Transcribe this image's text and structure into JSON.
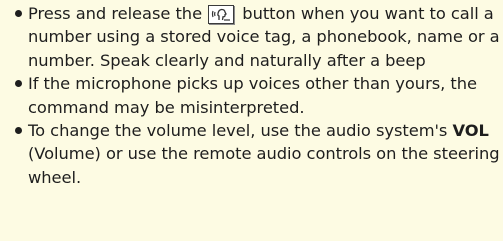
{
  "bullets": [
    {
      "before_icon": "Press and release the ",
      "icon": "talk-button-icon",
      "after_icon": " button when you want to call a number using a stored voice tag, a phonebook, name or a number. Speak clearly and naturally after a beep"
    },
    {
      "text": "If the microphone picks up voices other than yours, the command may be misinterpreted."
    },
    {
      "before_bold": "To change the volume level, use the audio system's ",
      "bold": "VOL",
      "after_bold": " (Volume) or use the remote audio controls on the steering wheel."
    }
  ]
}
